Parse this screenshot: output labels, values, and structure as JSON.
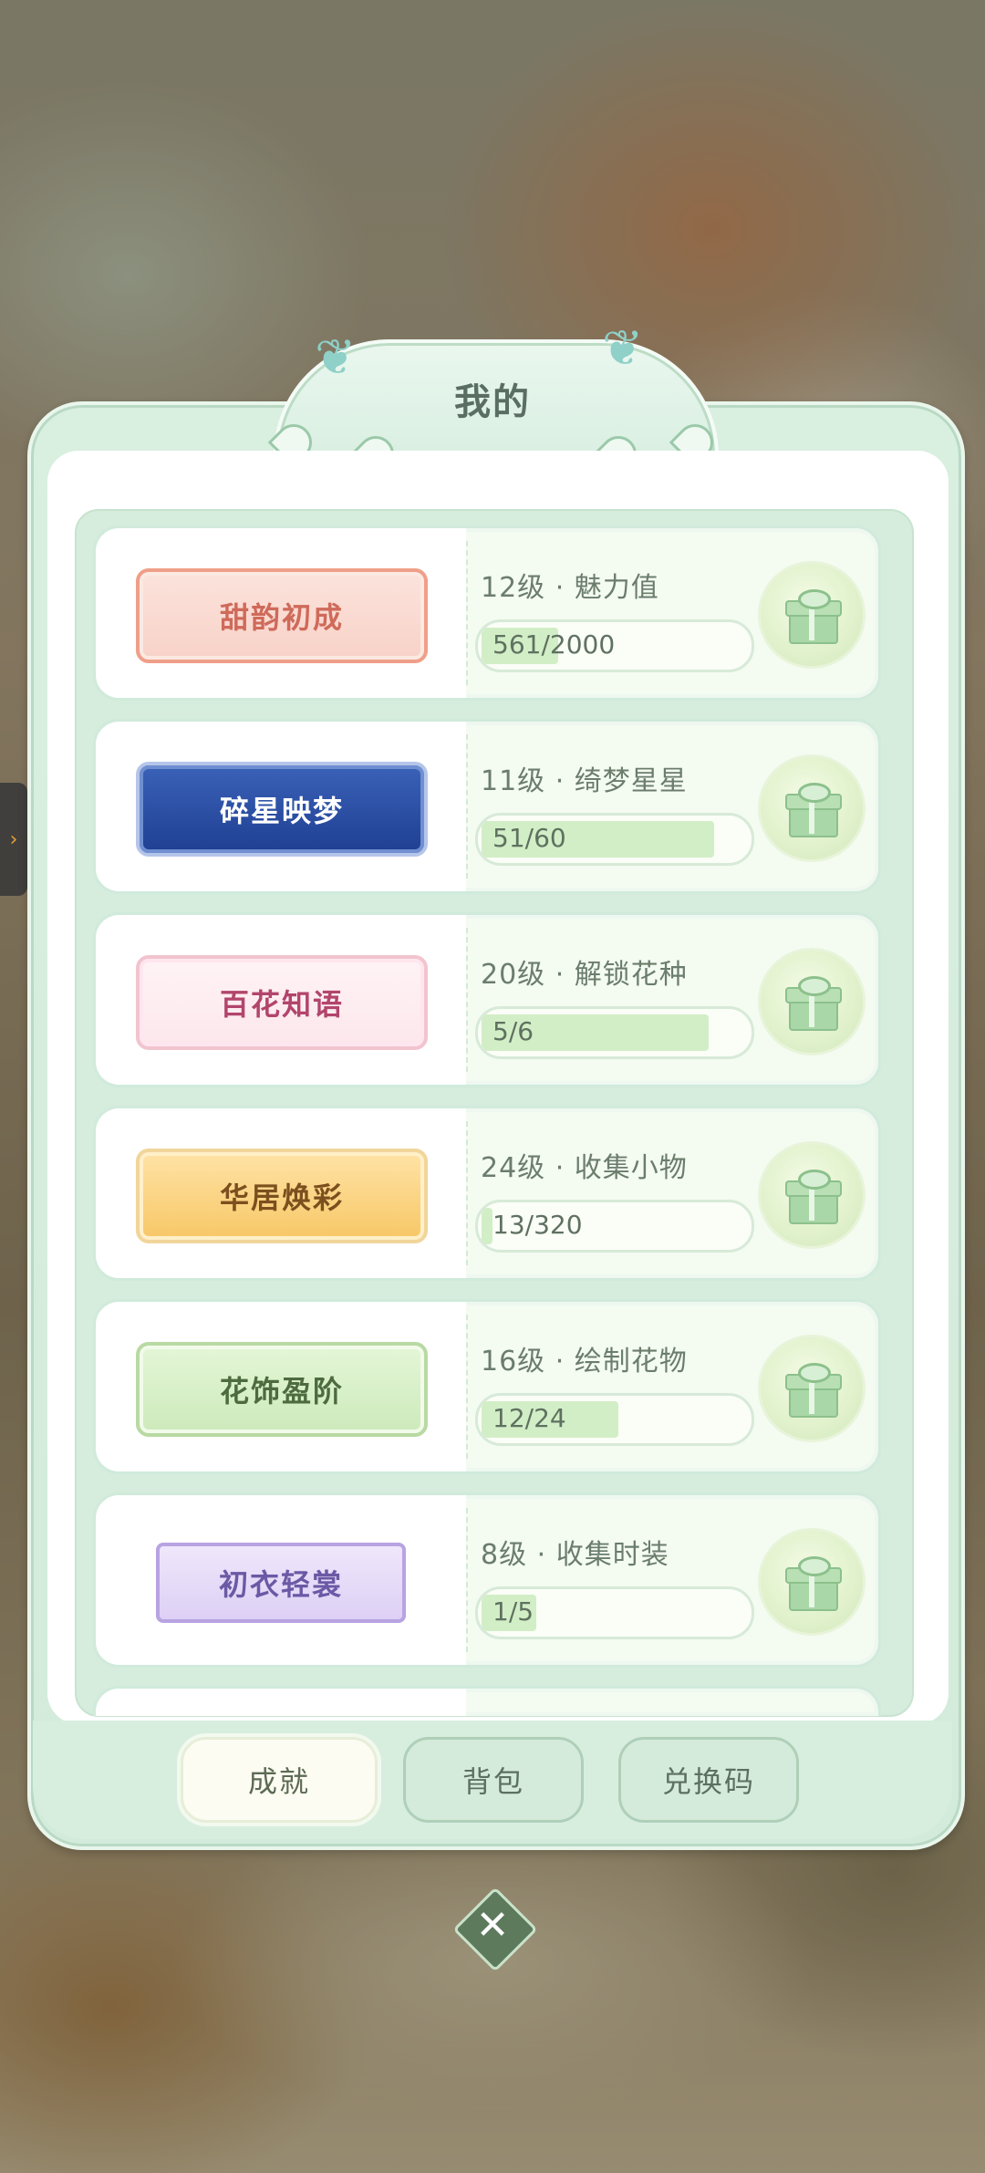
{
  "header": {
    "title": "我的"
  },
  "side_tab": {
    "glyph": "›"
  },
  "rows": [
    {
      "badge": "甜韵初成",
      "title": "12级 · 魅力值",
      "progress_text": "561/2000",
      "progress": 0.28,
      "badge_style": "coral"
    },
    {
      "badge": "碎星映梦",
      "title": "11级 · 绮梦星星",
      "progress_text": "51/60",
      "progress": 0.85,
      "badge_style": "blue"
    },
    {
      "badge": "百花知语",
      "title": "20级 · 解锁花种",
      "progress_text": "5/6",
      "progress": 0.83,
      "badge_style": "floral"
    },
    {
      "badge": "华居焕彩",
      "title": "24级 · 收集小物",
      "progress_text": "13/320",
      "progress": 0.04,
      "badge_style": "gold"
    },
    {
      "badge": "花饰盈阶",
      "title": "16级 · 绘制花物",
      "progress_text": "12/24",
      "progress": 0.5,
      "badge_style": "green"
    },
    {
      "badge": "初衣轻裳",
      "title": "8级 · 收集时装",
      "progress_text": "1/5",
      "progress": 0.2,
      "badge_style": "lilac"
    }
  ],
  "tabs": [
    {
      "label": "成就",
      "active": true
    },
    {
      "label": "背包",
      "active": false
    },
    {
      "label": "兑换码",
      "active": false
    }
  ],
  "close": {
    "glyph": "✕"
  },
  "colors": {
    "panel": "#d9efe0",
    "progress_fill": "#d2eec6",
    "text": "#6b7d6c"
  }
}
